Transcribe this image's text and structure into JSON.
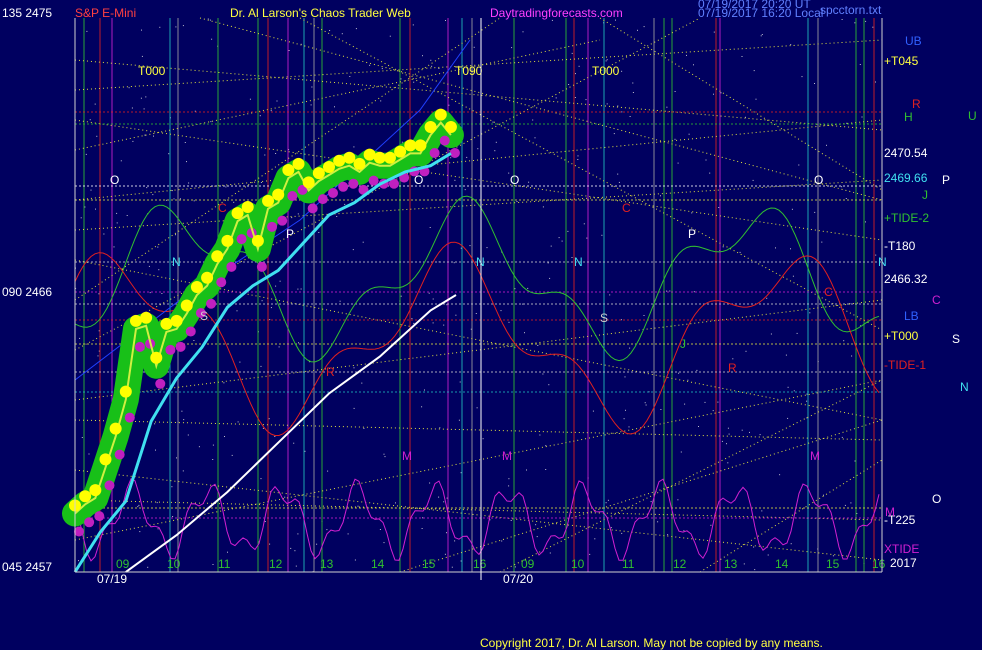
{
  "header": {
    "left_label": "135 2475",
    "symbol": "S&P E-Mini",
    "site_title": "Dr. Al Larson's Chaos Trader Web",
    "site_url": "Daytradingforecasts.com",
    "timestamp_line1": "07/19/2017 20:20 UT",
    "timestamp_line2": "07/19/2017 16:20 Local",
    "file_name": "spcctorn.txt"
  },
  "footer": {
    "copyright": "Copyright 2017, Dr. Al Larson. May not be copied by any means."
  },
  "colors": {
    "background": "#000060",
    "price_glow": "#18c018",
    "price_ball": "#ffff00",
    "price_low_ball": "#c020c0",
    "moving_average": "#40e0f0",
    "forecast_line": "#ffffff",
    "tide_red": "#e02020",
    "tide_green": "#30c030",
    "tide_magenta": "#d020d0",
    "tide_blue": "#2040ff",
    "grid_yellow": "#e0e040"
  },
  "chart_data": {
    "type": "line",
    "title": "S&P E-Mini",
    "y_axis": {
      "ylim": [
        2457,
        2475
      ],
      "tick_labels": [
        "135 2475",
        "090 2466",
        "045 2457"
      ]
    },
    "x_axis": {
      "hour_ticks": [
        "09",
        "10",
        "11",
        "12",
        "13",
        "14",
        "15",
        "16",
        "09",
        "10",
        "11",
        "12",
        "13",
        "14",
        "15",
        "16"
      ],
      "date_labels": [
        "07/19",
        "07/20"
      ],
      "year_label": "2017"
    },
    "right_levels": [
      {
        "label": "+T045",
        "value": 2473.6
      },
      {
        "label": "2470.54",
        "value": 2470.54
      },
      {
        "label": "2469.66",
        "value": 2469.66
      },
      {
        "label": "+TIDE-2",
        "value": 2468.8
      },
      {
        "label": "-T180",
        "value": 2467.8
      },
      {
        "label": "2466.32",
        "value": 2466.32
      },
      {
        "label": "+T000",
        "value": 2465.0
      },
      {
        "label": "-TIDE-1",
        "value": 2464.0
      },
      {
        "label": "-T225",
        "value": 2458.3
      },
      {
        "label": "XTIDE",
        "value": 2457.4
      }
    ],
    "right_side_markers": [
      "UB",
      "R",
      "H",
      "U",
      "P",
      "J",
      "C",
      "LB",
      "S",
      "N",
      "O",
      "M"
    ],
    "top_markers": [
      "T000",
      "T090",
      "T000"
    ],
    "series": [
      {
        "name": "S&P E-Mini",
        "x": [
          0.0,
          0.2,
          0.4,
          0.6,
          0.8,
          1.0,
          1.2,
          1.4,
          1.6,
          1.8,
          2.0,
          2.2,
          2.4,
          2.6,
          2.8,
          3.0,
          3.2,
          3.4,
          3.6,
          3.8,
          4.0,
          4.2,
          4.4,
          4.6,
          4.8,
          5.0,
          5.2,
          5.4,
          5.6,
          5.8,
          6.0,
          6.2,
          6.4,
          6.6,
          6.8,
          7.0,
          7.2,
          7.4
        ],
        "values": [
          2458.9,
          2459.2,
          2459.4,
          2460.4,
          2461.4,
          2462.6,
          2464.9,
          2465.0,
          2463.7,
          2464.8,
          2464.9,
          2465.4,
          2466.0,
          2466.3,
          2467.0,
          2467.5,
          2468.4,
          2468.6,
          2467.5,
          2468.8,
          2469.0,
          2469.8,
          2470.0,
          2469.4,
          2469.7,
          2469.9,
          2470.1,
          2470.2,
          2470.0,
          2470.3,
          2470.2,
          2470.2,
          2470.4,
          2470.6,
          2470.6,
          2471.2,
          2471.6,
          2471.2
        ]
      },
      {
        "name": "moving average",
        "x": [
          0.0,
          0.5,
          1.0,
          1.5,
          2.0,
          2.5,
          3.0,
          3.5,
          4.0,
          4.5,
          5.0,
          5.5,
          6.0,
          6.5,
          7.0,
          7.4
        ],
        "values": [
          2457.0,
          2458.3,
          2459.3,
          2461.9,
          2463.3,
          2464.3,
          2465.6,
          2466.3,
          2466.8,
          2467.7,
          2468.6,
          2469.0,
          2469.6,
          2470.0,
          2470.2,
          2470.6
        ]
      },
      {
        "name": "forecast",
        "x": [
          1.0,
          2.0,
          3.0,
          4.0,
          5.0,
          6.0,
          7.0,
          7.5
        ],
        "values": [
          2457.0,
          2458.2,
          2459.6,
          2461.2,
          2462.8,
          2464.0,
          2465.5,
          2466.0
        ]
      }
    ]
  }
}
